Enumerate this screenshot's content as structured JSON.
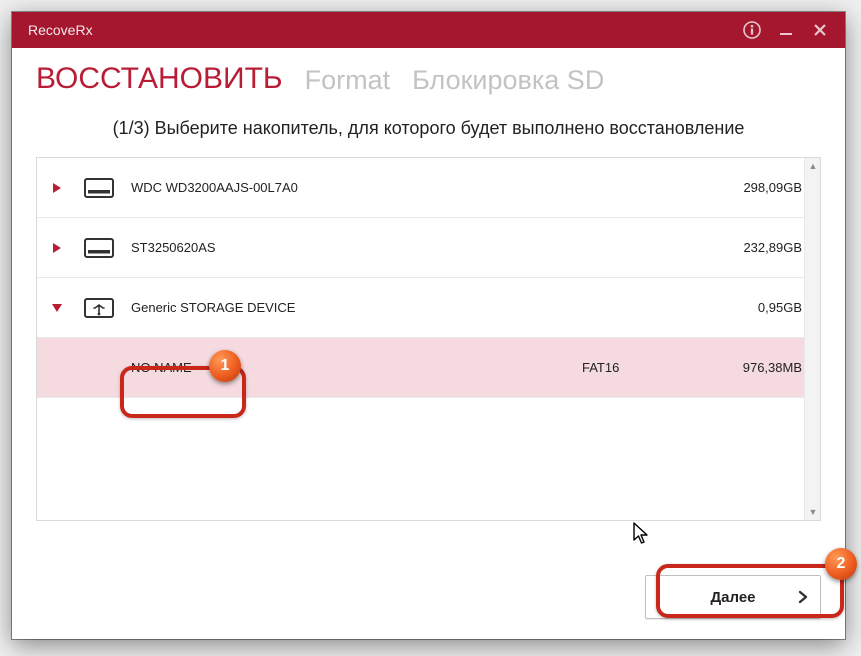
{
  "colors": {
    "brand": "#a5172f",
    "highlight": "#c8271a"
  },
  "window": {
    "title": "RecoveRx"
  },
  "nav": {
    "tabs": [
      {
        "label": "ВОССТАНОВИТЬ",
        "active": true
      },
      {
        "label": "Format",
        "active": false
      },
      {
        "label": "Блокировка SD",
        "active": false
      }
    ]
  },
  "step": {
    "instruction": "(1/3) Выберите накопитель, для которого будет выполнено восстановление"
  },
  "drives": [
    {
      "type": "hdd",
      "name": "WDC WD3200AAJS-00L7A0",
      "fs": "",
      "size": "298,09GB",
      "expanded": false
    },
    {
      "type": "hdd",
      "name": "ST3250620AS",
      "fs": "",
      "size": "232,89GB",
      "expanded": false
    },
    {
      "type": "usb",
      "name": "Generic STORAGE DEVICE",
      "fs": "",
      "size": "0,95GB",
      "expanded": true,
      "partitions": [
        {
          "name": "NO NAME",
          "fs": "FAT16",
          "size": "976,38MB",
          "selected": true
        }
      ]
    }
  ],
  "buttons": {
    "next": "Далее"
  },
  "callouts": {
    "one": "1",
    "two": "2"
  }
}
